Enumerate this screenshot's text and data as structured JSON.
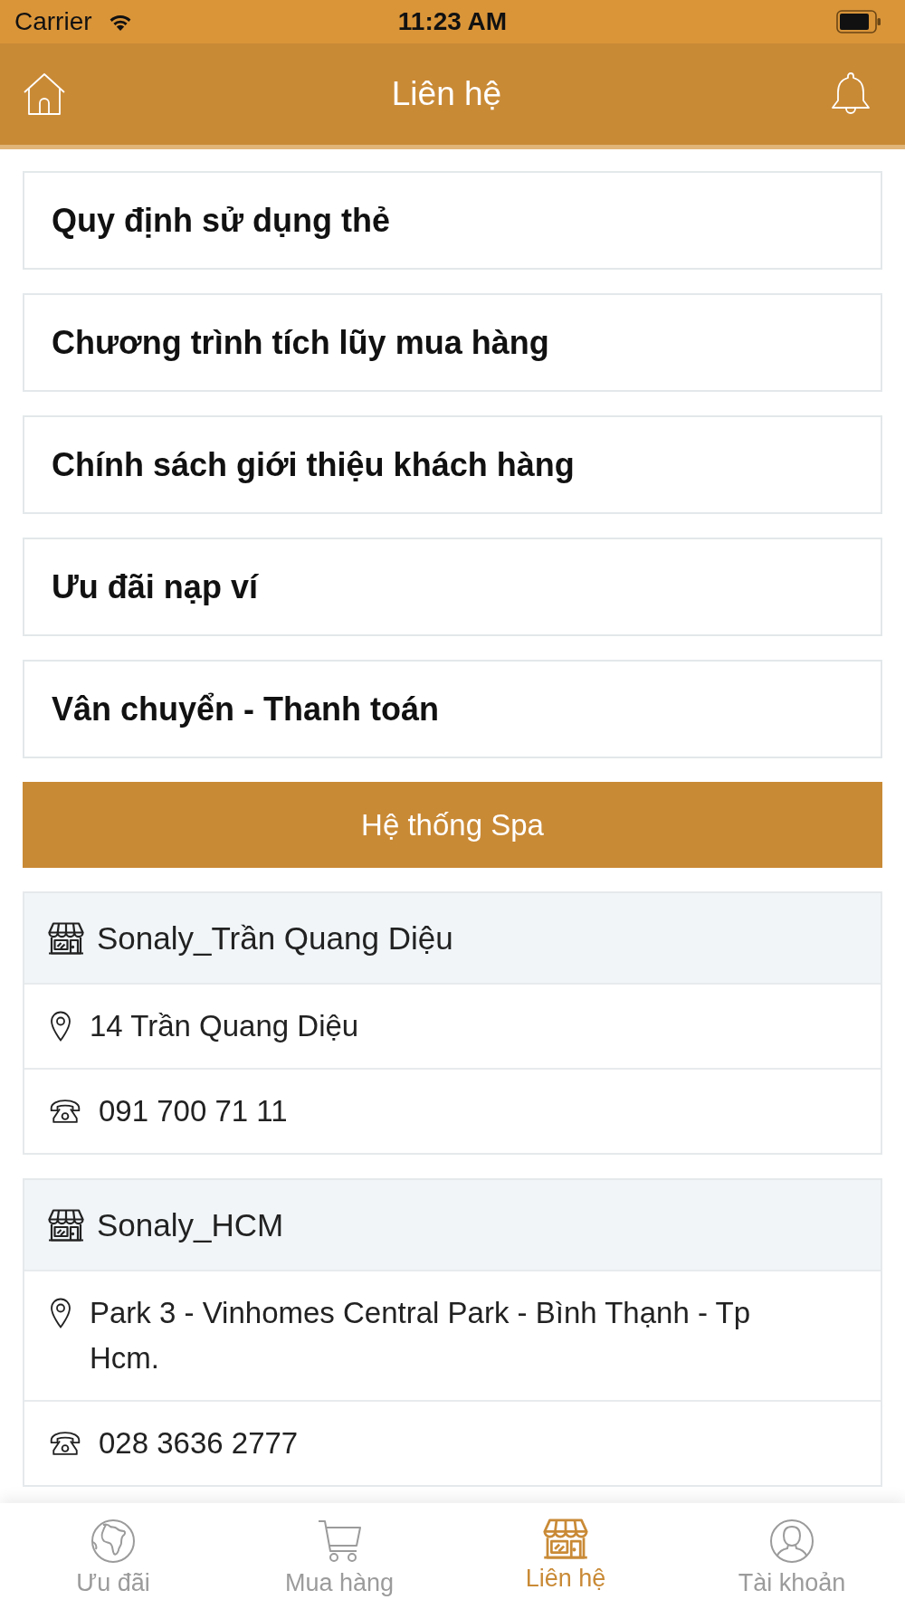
{
  "status_bar": {
    "carrier": "Carrier",
    "time": "11:23 AM"
  },
  "header": {
    "title": "Liên hệ"
  },
  "menu_items": [
    {
      "label": "Quy định sử dụng thẻ"
    },
    {
      "label": "Chương trình tích lũy mua hàng"
    },
    {
      "label": "Chính sách giới thiệu khách hàng"
    },
    {
      "label": "Ưu đãi nạp ví"
    },
    {
      "label": "Vân chuyển - Thanh toán"
    }
  ],
  "section_header": {
    "label": "Hệ thống Spa"
  },
  "spas": [
    {
      "name": "Sonaly_Trần Quang Diệu",
      "address": "14 Trần Quang Diệu",
      "phone": "091 700 71 11"
    },
    {
      "name": "Sonaly_HCM",
      "address": "Park 3 - Vinhomes Central Park - Bình Thạnh - Tp Hcm.",
      "phone": "028 3636 2777"
    }
  ],
  "tab_bar": [
    {
      "label": "Ưu đãi",
      "selected": false
    },
    {
      "label": "Mua hàng",
      "selected": false
    },
    {
      "label": "Liên hệ",
      "selected": true
    },
    {
      "label": "Tài khoản",
      "selected": false
    }
  ]
}
